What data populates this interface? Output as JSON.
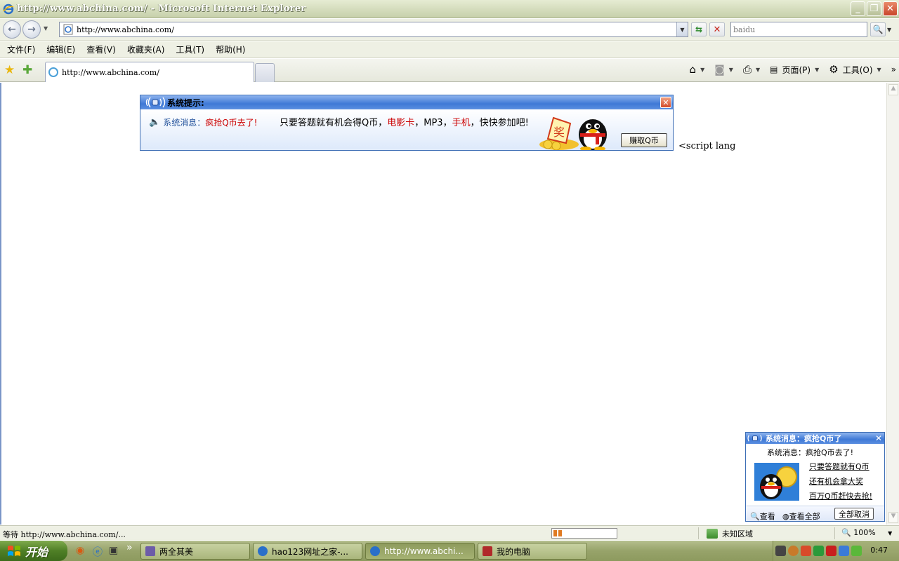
{
  "window": {
    "title": "http://www.abchina.com/ - Microsoft Internet Explorer"
  },
  "address_bar": {
    "url": "http://www.abchina.com/",
    "search_value": "baidu"
  },
  "menu": {
    "items": [
      "文件(F)",
      "编辑(E)",
      "查看(V)",
      "收藏夹(A)",
      "工具(T)",
      "帮助(H)"
    ]
  },
  "tab": {
    "label": "http://www.abchina.com/"
  },
  "command_bar": {
    "page_label": "页面(P)",
    "tools_label": "工具(O)"
  },
  "popup": {
    "title": "系统提示:",
    "msg_label": "系统消息：",
    "msg_highlight": "疯抢Q币去了!",
    "main_part1": "只要答题就有机会得Q币，",
    "main_red1": "电影卡",
    "main_part2": "，MP3，",
    "main_red2": "手机",
    "main_part3": "，快快参加吧!",
    "badge_text": "奖",
    "button_label": "赚取Q币"
  },
  "page_text": "<script lang",
  "notification": {
    "title": "系统消息：疯抢Q币了",
    "subtitle": "系统消息：疯抢Q币去了!",
    "links": [
      "只要答题就有Q币",
      "还有机会拿大奖",
      "百万Q币赶快去抢!"
    ],
    "view_label": "查看",
    "view_all_label": "查看全部",
    "cancel_all_label": "全部取消"
  },
  "status": {
    "text": "等待 http://www.abchina.com/...",
    "progress": 0.15,
    "zone": "未知区域",
    "zoom": "100%"
  },
  "taskbar": {
    "start_label": "开始",
    "buttons": [
      {
        "label": "两全其美",
        "active": false
      },
      {
        "label": "hao123网址之家-...",
        "active": false
      },
      {
        "label": "http://www.abchi...",
        "active": true
      },
      {
        "label": "我的电脑",
        "active": false
      }
    ],
    "clock": "0:47"
  },
  "colors": {
    "accent_red": "#cc0000",
    "popup_blue": "#3f79d6",
    "progress_orange": "#e07b22"
  }
}
